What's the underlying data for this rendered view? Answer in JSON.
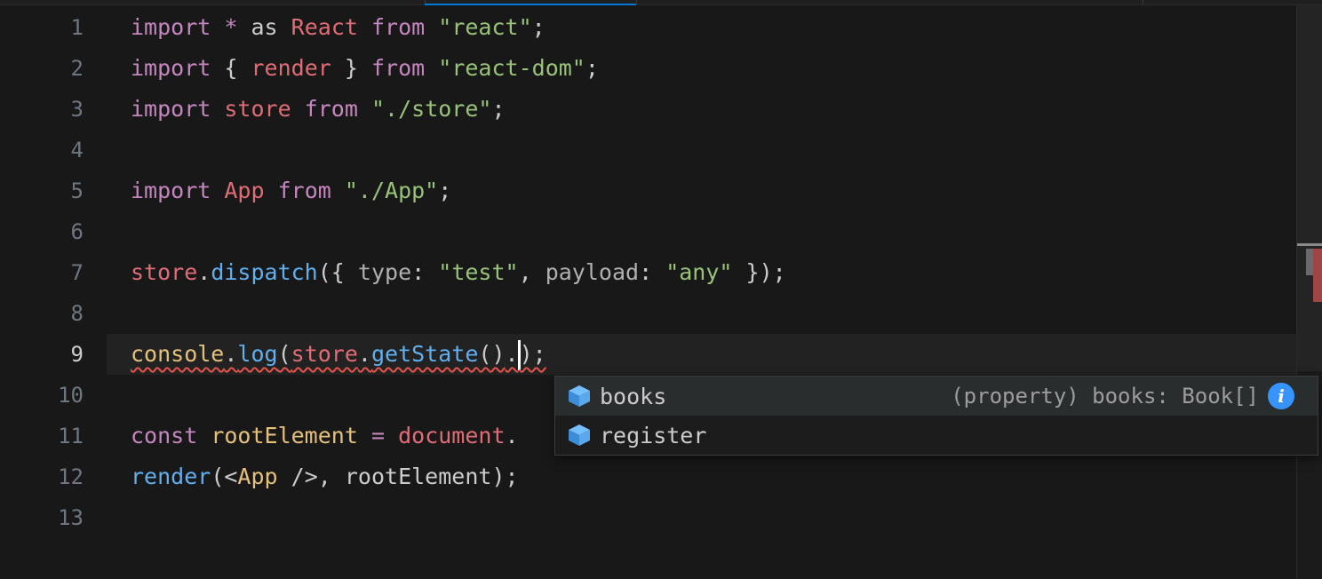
{
  "gutter": {
    "line_numbers": [
      "1",
      "2",
      "3",
      "4",
      "5",
      "6",
      "7",
      "8",
      "9",
      "10",
      "11",
      "12",
      "13"
    ],
    "active_line": "9"
  },
  "code": {
    "l1": {
      "import": "import",
      "star": "*",
      "as": "as",
      "React": "React",
      "from": "from",
      "module": "\"react\"",
      "semi": ";"
    },
    "l2": {
      "import": "import",
      "ob": "{",
      "render": "render",
      "cb": "}",
      "from": "from",
      "module": "\"react-dom\"",
      "semi": ";"
    },
    "l3": {
      "import": "import",
      "store": "store",
      "from": "from",
      "module": "\"./store\"",
      "semi": ";"
    },
    "l5": {
      "import": "import",
      "App": "App",
      "from": "from",
      "module": "\"./App\"",
      "semi": ";"
    },
    "l7": {
      "store": "store",
      "dot": ".",
      "dispatch": "dispatch",
      "open": "({",
      "type": "type",
      "colon1": ":",
      "test": "\"test\"",
      "comma": ",",
      "payload": "payload",
      "colon2": ":",
      "any": "\"any\"",
      "close": "});"
    },
    "l9": {
      "console": "console",
      "dot1": ".",
      "log": "log",
      "open": "(",
      "store": "store",
      "dot2": ".",
      "getState": "getState",
      "parens": "()",
      "dot3": ".",
      "close": ");"
    },
    "l11": {
      "const": "const",
      "rootElement": "rootElement",
      "eq": "=",
      "document": "document",
      "dot": "."
    },
    "l12": {
      "render": "render",
      "open": "(<",
      "App": "App",
      "selfclose": "/>,",
      "rootElement": "rootElement",
      "close": ");"
    }
  },
  "suggest": {
    "items": [
      {
        "label": "books",
        "detail": "(property) books: Book[]",
        "icon": "property-icon",
        "info_icon": "info-icon"
      },
      {
        "label": "register",
        "icon": "property-icon"
      }
    ]
  },
  "colors": {
    "keyword": "#c586c0",
    "variable": "#e06c75",
    "string": "#98c379",
    "function": "#61afef",
    "object": "#e5c07b",
    "accent": "#0078d4",
    "error": "#e5534b"
  }
}
